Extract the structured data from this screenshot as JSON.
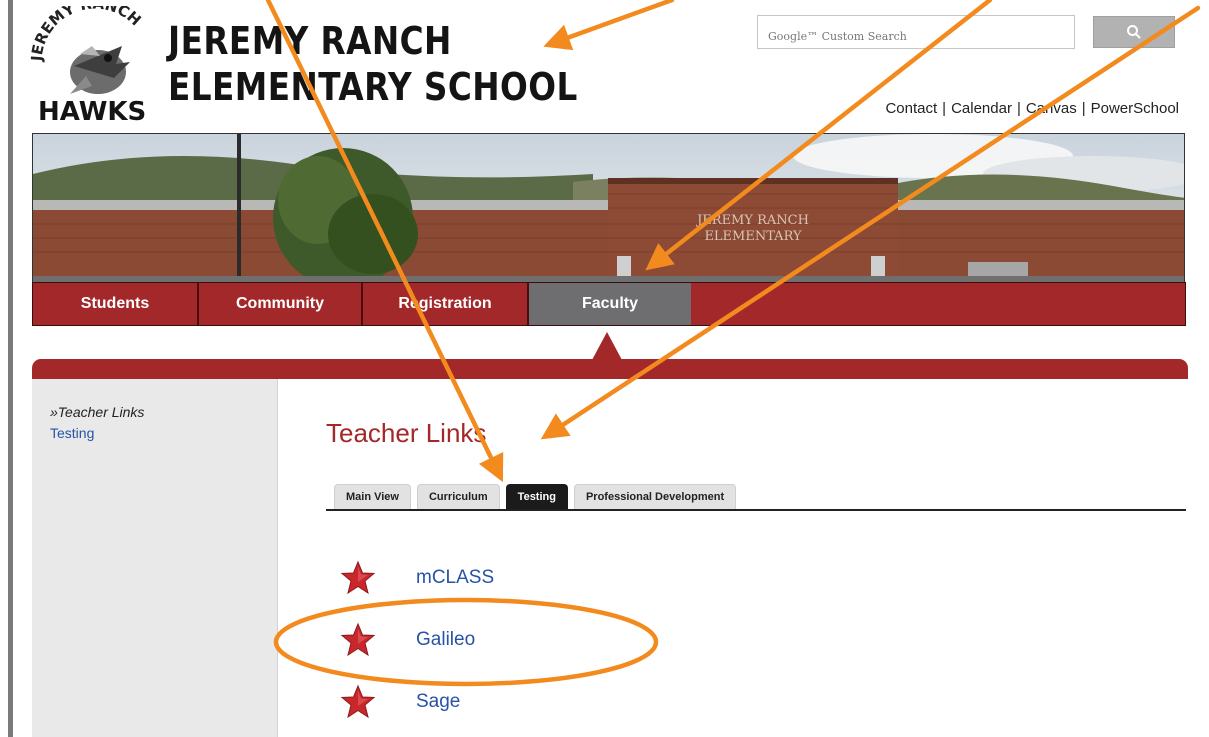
{
  "header": {
    "school_name_line1": "JEREMY RANCH",
    "school_name_line2": "ELEMENTARY SCHOOL",
    "logo_text_top": "JEREMY RANCH",
    "logo_text_bottom": "HAWKS",
    "search": {
      "placeholder": "Google™ Custom Search",
      "button_icon": "search-icon"
    },
    "utility_links": [
      "Contact",
      "Calendar",
      "Canvas",
      "PowerSchool"
    ],
    "separator": "|"
  },
  "banner": {
    "building_sign_line1": "JEREMY RANCH",
    "building_sign_line2": "ELEMENTARY"
  },
  "main_nav": {
    "tabs": [
      {
        "label": "Students"
      },
      {
        "label": "Community"
      },
      {
        "label": "Registration"
      },
      {
        "label": "Faculty",
        "active": true
      }
    ]
  },
  "sidebar": {
    "current": "»Teacher Links",
    "links": [
      "Testing"
    ]
  },
  "main": {
    "title": "Teacher Links",
    "sub_tabs": [
      {
        "label": "Main View"
      },
      {
        "label": "Curriculum"
      },
      {
        "label": "Testing",
        "active": true
      },
      {
        "label": "Professional Development"
      }
    ],
    "links": [
      {
        "label": "mCLASS",
        "icon": "star-icon"
      },
      {
        "label": "Galileo",
        "icon": "star-icon"
      },
      {
        "label": "Sage",
        "icon": "star-icon"
      }
    ]
  },
  "colors": {
    "brand_red": "#a3282a",
    "active_tab_gray": "#6e6e70",
    "link_blue": "#2753a5",
    "annotation_orange": "#f28a1e"
  }
}
